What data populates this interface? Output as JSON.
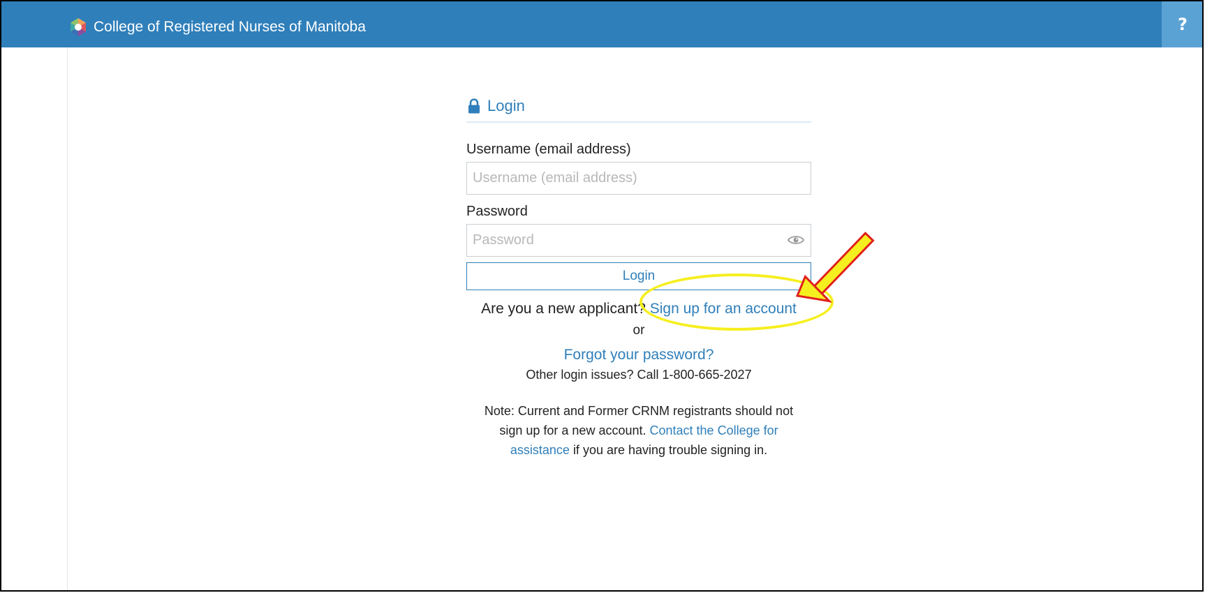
{
  "header": {
    "brand_name": "College of Registered Nurses of Manitoba",
    "help_label": "?",
    "background_color": "#2f7fba"
  },
  "login": {
    "title": "Login",
    "title_icon": "lock-icon",
    "username": {
      "label": "Username (email address)",
      "placeholder": "Username (email address)",
      "value": ""
    },
    "password": {
      "label": "Password",
      "placeholder": "Password",
      "value": "",
      "toggle_icon": "eye-icon"
    },
    "login_button_label": "Login",
    "applicant_prompt": "Are you a new applicant?",
    "signup_link_label": "Sign up for an account",
    "or_text": "or",
    "forgot_password_label": "Forgot your password?",
    "other_issues_text": "Other login issues? Call 1-800-665-2027",
    "note": {
      "prefix": "Note: Current and Former CRNM registrants should not sign up for a new account.",
      "link_label": "Contact the College for assistance",
      "suffix": "if you are having trouble signing in."
    }
  },
  "annotations": {
    "highlight_color": "#f6ef1f",
    "arrow_fill_color": "#f6ef1f",
    "arrow_outline_color": "#e0201b"
  }
}
